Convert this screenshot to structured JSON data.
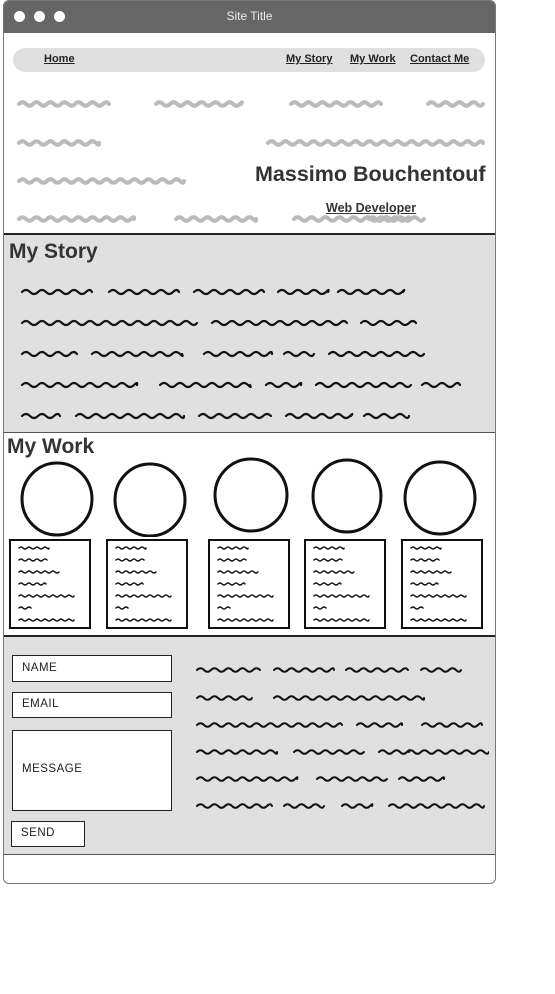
{
  "window": {
    "title": "Site Title"
  },
  "nav": {
    "home": "Home",
    "story": "My Story",
    "work": "My Work",
    "contact": "Contact Me"
  },
  "hero": {
    "name": "Massimo Bouchentouf",
    "role": "Web Developer"
  },
  "story": {
    "title": "My Story"
  },
  "work": {
    "title": "My Work",
    "items": 5
  },
  "contact": {
    "name_label": "NAME",
    "email_label": "EMAIL",
    "message_label": "MESSAGE",
    "send_label": "SEND"
  },
  "colors": {
    "titlebar": "#666666",
    "panel": "#e0e0e0",
    "ink": "#111111",
    "placeholder_scribble": "#bbbbbb"
  }
}
